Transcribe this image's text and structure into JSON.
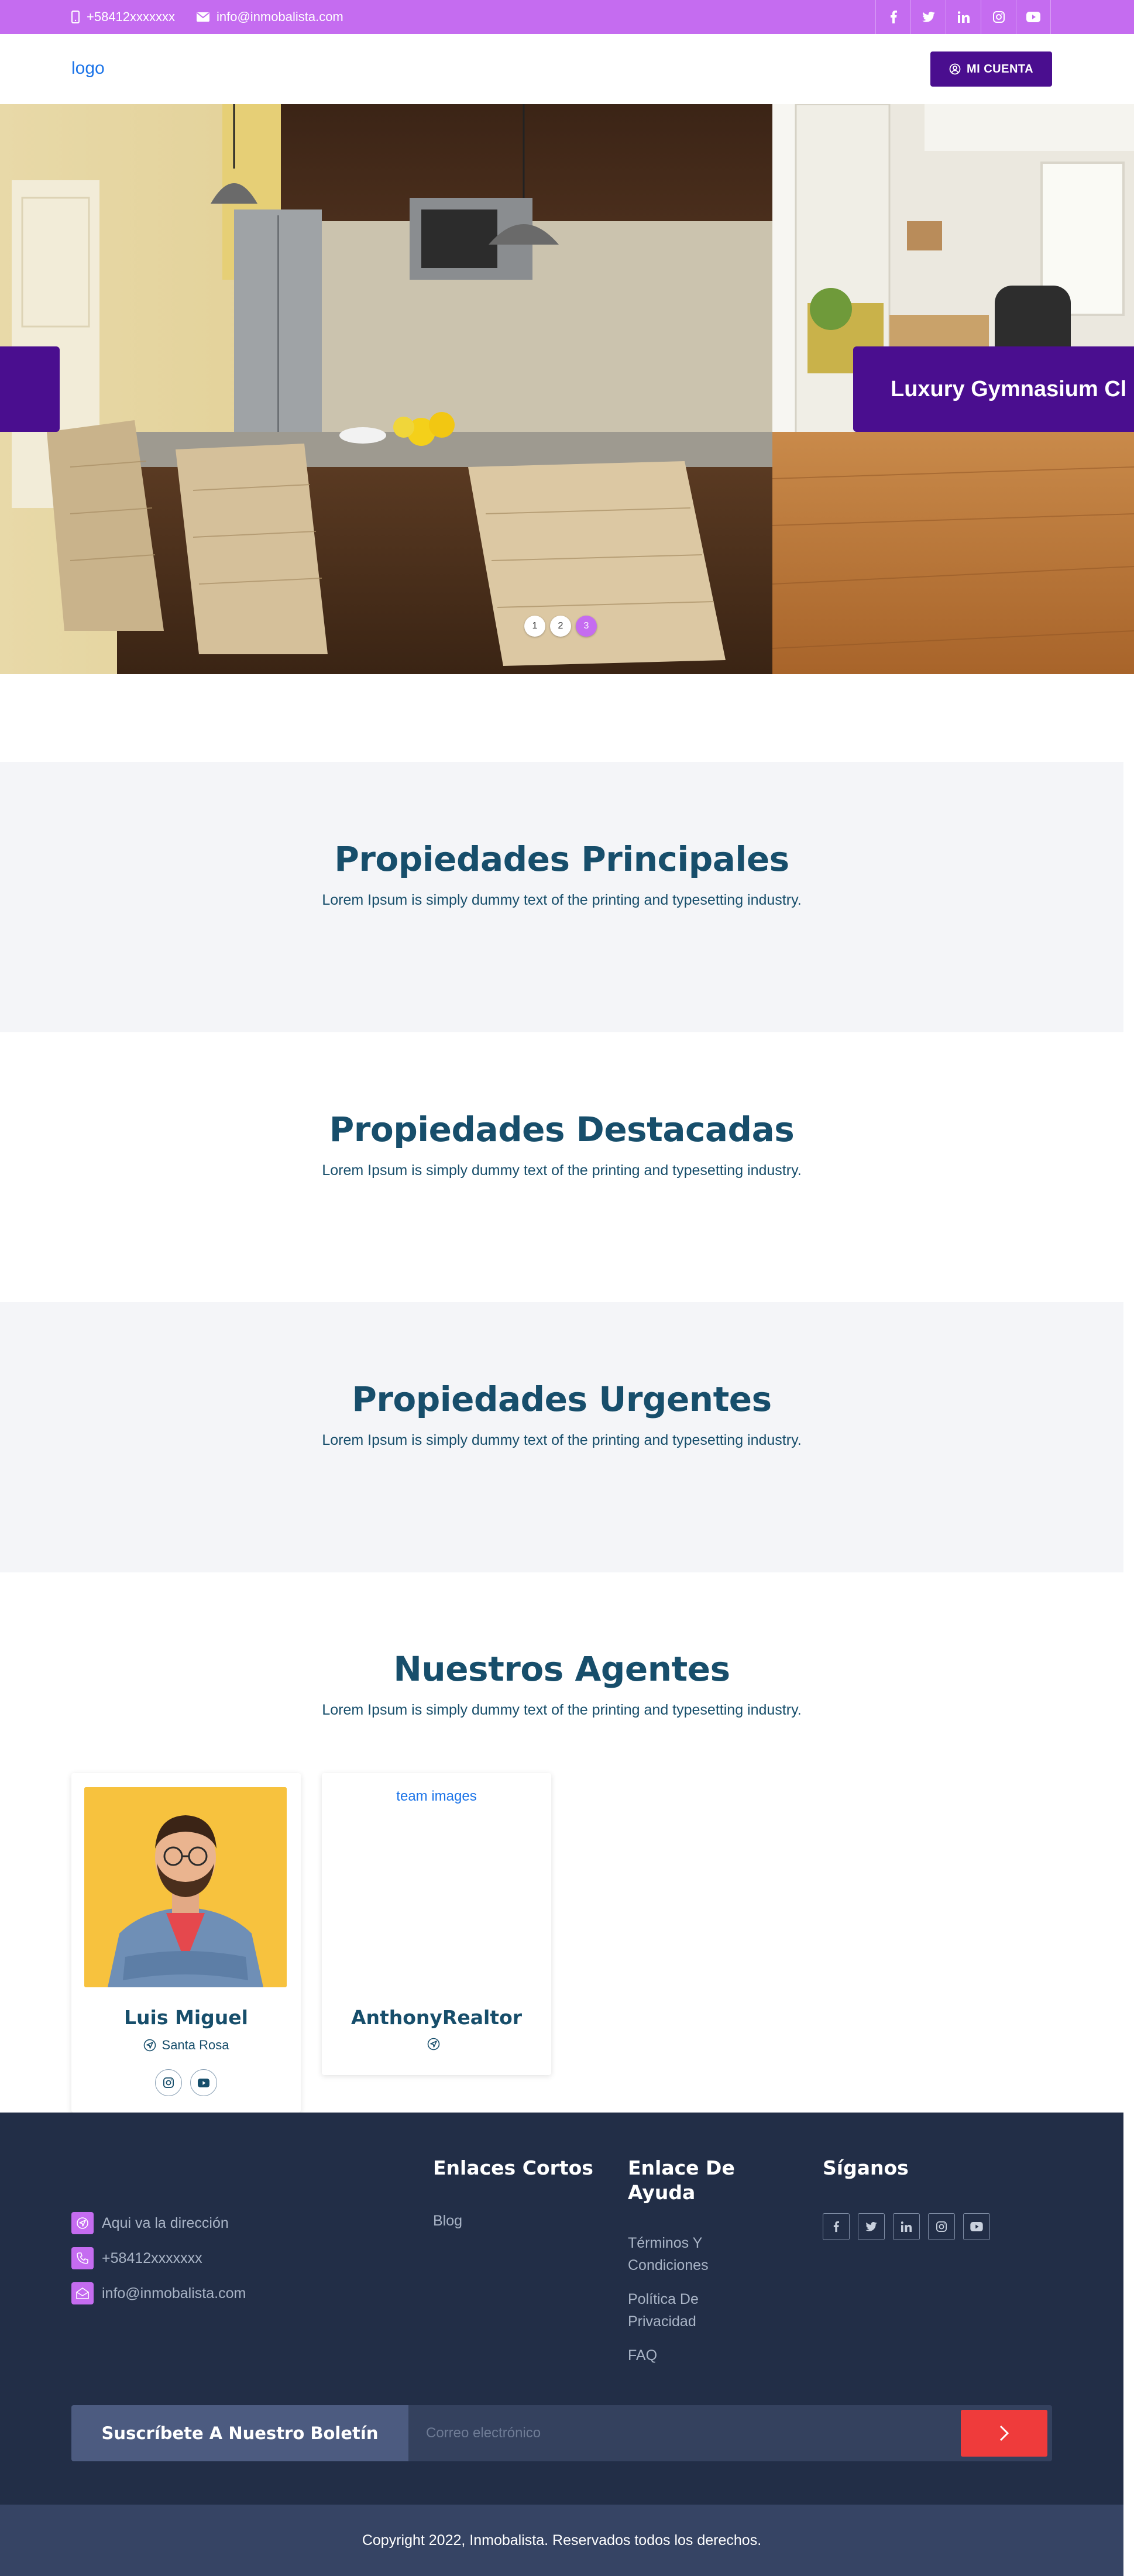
{
  "topbar": {
    "phone": "+58412xxxxxxx",
    "email": "info@inmobalista.com",
    "socials": [
      "facebook-icon",
      "twitter-icon",
      "linkedin-icon",
      "instagram-icon",
      "youtube-icon"
    ],
    "bg_color": "#c56cf0"
  },
  "header": {
    "logo": "logo",
    "account_button": "MI CUENTA",
    "account_color": "#4a0e8f"
  },
  "hero": {
    "slide_label": "Luxury Gymnasium Cl",
    "dots": [
      "1",
      "2",
      "3"
    ],
    "active_dot": "3"
  },
  "sections": [
    {
      "title": "Propiedades Principales",
      "subtitle": "Lorem Ipsum is simply dummy text of the printing and typesetting industry."
    },
    {
      "title": "Propiedades Destacadas",
      "subtitle": "Lorem Ipsum is simply dummy text of the printing and typesetting industry."
    },
    {
      "title": "Propiedades Urgentes",
      "subtitle": "Lorem Ipsum is simply dummy text of the printing and typesetting industry."
    },
    {
      "title": "Nuestros Agentes",
      "subtitle": "Lorem Ipsum is simply dummy text of the printing and typesetting industry."
    }
  ],
  "agents": [
    {
      "name": "Luis Miguel",
      "location": "Santa Rosa",
      "socials": [
        "instagram-icon",
        "youtube-icon"
      ]
    },
    {
      "name": "AnthonyRealtor",
      "location": "",
      "image_alt": "team images"
    }
  ],
  "footer": {
    "contact": {
      "address": "Aqui va la dirección",
      "phone": "+58412xxxxxxx",
      "email": "info@inmobalista.com"
    },
    "short_links": {
      "title": "Enlaces Cortos",
      "items": [
        "Blog"
      ]
    },
    "help": {
      "title_line1": "Enlace De",
      "title_line2": "Ayuda",
      "items": [
        [
          "Términos Y",
          "Condiciones"
        ],
        [
          "Política De",
          "Privacidad"
        ],
        [
          "FAQ"
        ]
      ]
    },
    "follow": {
      "title": "Síganos",
      "socials": [
        "facebook-icon",
        "twitter-icon",
        "linkedin-icon",
        "instagram-icon",
        "youtube-icon"
      ]
    },
    "newsletter": {
      "label": "Suscríbete A Nuestro Boletín",
      "placeholder": "Correo electrónico"
    },
    "copyright": "Copyright 2022, Inmobalista. Reservados todos los derechos."
  }
}
